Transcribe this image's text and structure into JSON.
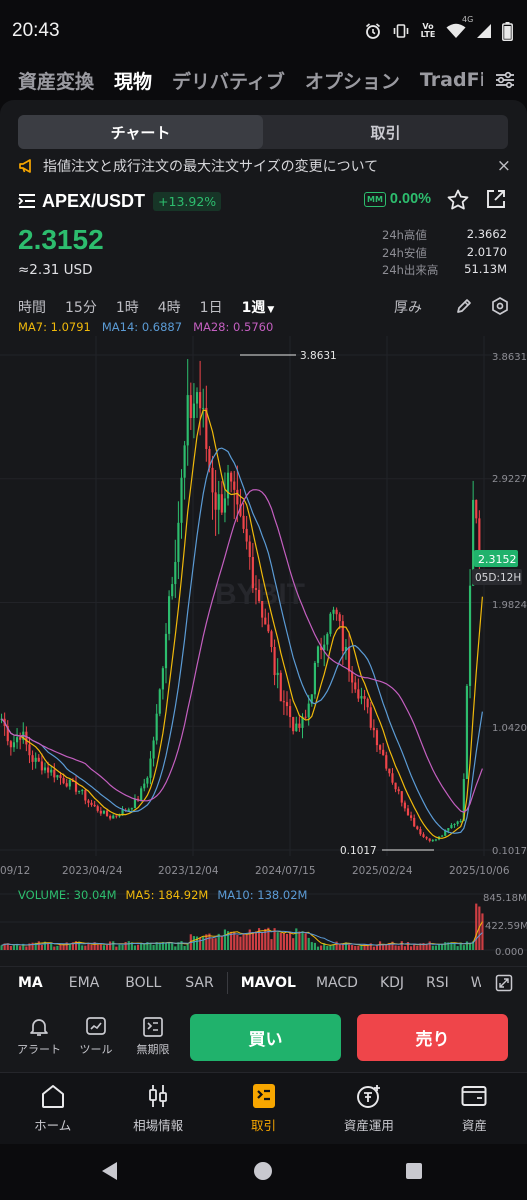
{
  "status_bar": {
    "time": "20:43",
    "network": "4G",
    "volte": "Vo LTE"
  },
  "top_tabs": [
    "資産変換",
    "現物",
    "デリバティブ",
    "オプション",
    "TradFi"
  ],
  "segment": {
    "chart": "チャート",
    "trade": "取引"
  },
  "notice": {
    "text": "指値注文と成行注文の最大注文サイズの変更について",
    "close": "×"
  },
  "pair": {
    "name": "APEX/USDT",
    "change": "+13.92%",
    "mm_badge": "MM",
    "mm_value": "0.00%",
    "price": "2.3152",
    "usd_price": "≈2.31 USD"
  },
  "stats": [
    {
      "label": "24h高値",
      "value": "2.3662"
    },
    {
      "label": "24h安値",
      "value": "2.0170"
    },
    {
      "label": "24h出来高",
      "value": "51.13M"
    }
  ],
  "timeframes": [
    "時間",
    "15分",
    "1時",
    "4時",
    "1日",
    "1週"
  ],
  "timeframe_active": "1週",
  "chart_tools": {
    "thickness": "厚み"
  },
  "ma_legend": [
    {
      "text": "MA7: 1.0791",
      "color": "#f0b90b"
    },
    {
      "text": "MA14: 0.6887",
      "color": "#5b9bd5"
    },
    {
      "text": "MA28: 0.5760",
      "color": "#c45fc0"
    }
  ],
  "vol_legend": [
    {
      "text": "VOLUME: 30.04M",
      "color": "#2dbd6e"
    },
    {
      "text": "MA5: 184.92M",
      "color": "#f0b90b"
    },
    {
      "text": "MA10: 138.02M",
      "color": "#5b9bd5"
    }
  ],
  "chart_data": {
    "type": "candlestick",
    "title": "",
    "x_ticks": [
      "09/12",
      "2023/04/24",
      "2023/12/04",
      "2024/07/15",
      "2025/02/24",
      "2025/10/06"
    ],
    "y_ticks": [
      "3.8631",
      "2.9227",
      "1.9824",
      "1.0420",
      "0.1017"
    ],
    "ylim": [
      0.1017,
      3.8631
    ],
    "high_marker": "3.8631",
    "low_marker": "0.1017",
    "current_price": "2.3152",
    "countdown": "05D:12H",
    "watermark": "BYBIT",
    "close_series": [
      1.1,
      0.9,
      1.0,
      0.8,
      0.75,
      0.7,
      0.65,
      0.6,
      0.55,
      0.45,
      0.4,
      0.35,
      0.38,
      0.42,
      0.5,
      0.7,
      1.2,
      2.0,
      2.6,
      3.4,
      3.6,
      3.1,
      2.7,
      2.9,
      2.6,
      2.4,
      2.1,
      1.8,
      1.4,
      1.2,
      1.0,
      1.1,
      1.5,
      1.8,
      1.9,
      1.6,
      1.4,
      1.2,
      1.0,
      0.8,
      0.6,
      0.45,
      0.3,
      0.2,
      0.17,
      0.22,
      0.3,
      0.35,
      2.9,
      2.3152
    ],
    "volume": {
      "y_ticks": [
        "845.18M",
        "422.59M",
        "0.000"
      ]
    }
  },
  "indicators": [
    "MA",
    "EMA",
    "BOLL",
    "SAR",
    "MAVOL",
    "MACD",
    "KDJ",
    "RSI",
    "W"
  ],
  "indicators_active": [
    "MA",
    "MAVOL"
  ],
  "tools": [
    {
      "label": "アラート",
      "icon": "bell-icon"
    },
    {
      "label": "ツール",
      "icon": "chart-tool-icon"
    },
    {
      "label": "無期限",
      "icon": "perpetual-icon"
    }
  ],
  "buy_label": "買い",
  "sell_label": "売り",
  "nav": [
    {
      "label": "ホーム",
      "icon": "home-icon"
    },
    {
      "label": "相場情報",
      "icon": "market-icon"
    },
    {
      "label": "取引",
      "icon": "trade-icon"
    },
    {
      "label": "資産運用",
      "icon": "earn-icon"
    },
    {
      "label": "資産",
      "icon": "wallet-icon"
    }
  ],
  "nav_active": "取引",
  "colors": {
    "up": "#2dbd6e",
    "down": "#ef454a",
    "accent": "#f7a600"
  }
}
